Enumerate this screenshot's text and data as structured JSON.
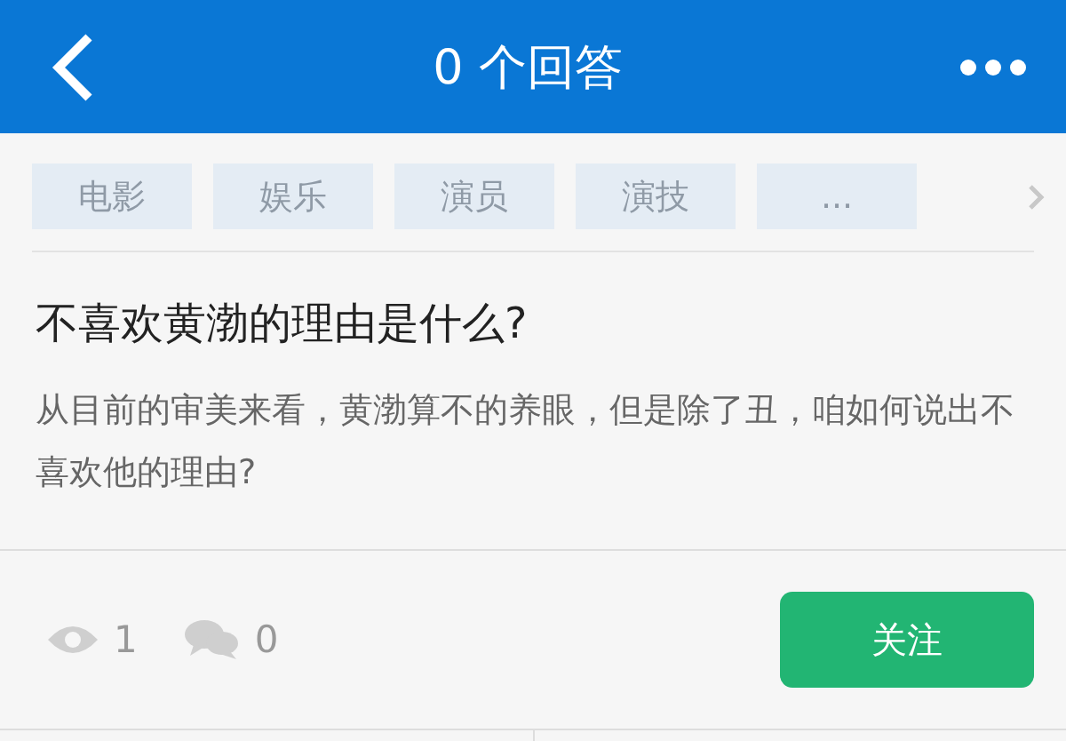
{
  "header": {
    "title": "0 个回答"
  },
  "tags": [
    "电影",
    "娱乐",
    "演员",
    "演技",
    "..."
  ],
  "question": {
    "title": "不喜欢黄渤的理由是什么?",
    "description": "从目前的审美来看，黄渤算不的养眼，但是除了丑，咱如何说出不喜欢他的理由?"
  },
  "stats": {
    "views": "1",
    "comments": "0"
  },
  "follow_button": "关注"
}
